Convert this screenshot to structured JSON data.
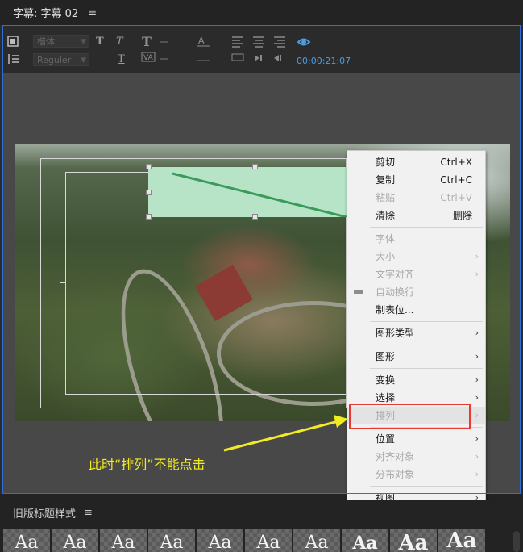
{
  "panel": {
    "title": "字幕: 字幕 02",
    "menu": "≡"
  },
  "toolbar": {
    "font_family": "楷体",
    "font_style": "Reguler",
    "bold_glyph": "T",
    "italic_glyph": "T",
    "underline_glyph": "T",
    "timecode": "00:00:21:07"
  },
  "context_menu": {
    "items": [
      {
        "label": "剪切",
        "shortcut": "Ctrl+X",
        "enabled": true
      },
      {
        "label": "复制",
        "shortcut": "Ctrl+C",
        "enabled": true
      },
      {
        "label": "粘贴",
        "shortcut": "Ctrl+V",
        "enabled": false
      },
      {
        "label": "清除",
        "shortcut": "删除",
        "enabled": true
      },
      {
        "label": "字体",
        "shortcut": "",
        "enabled": false
      },
      {
        "label": "大小",
        "shortcut": "›",
        "enabled": false
      },
      {
        "label": "文字对齐",
        "shortcut": "›",
        "enabled": false
      },
      {
        "label": "自动换行",
        "shortcut": "",
        "enabled": false
      },
      {
        "label": "制表位...",
        "shortcut": "",
        "enabled": true
      },
      {
        "label": "图形类型",
        "shortcut": "›",
        "enabled": true
      },
      {
        "label": "图形",
        "shortcut": "›",
        "enabled": true
      },
      {
        "label": "变换",
        "shortcut": "›",
        "enabled": true
      },
      {
        "label": "选择",
        "shortcut": "›",
        "enabled": true
      },
      {
        "label": "排列",
        "shortcut": "›",
        "enabled": false
      },
      {
        "label": "位置",
        "shortcut": "›",
        "enabled": true
      },
      {
        "label": "对齐对象",
        "shortcut": "›",
        "enabled": false
      },
      {
        "label": "分布对象",
        "shortcut": "›",
        "enabled": false
      },
      {
        "label": "视图",
        "shortcut": "›",
        "enabled": true
      }
    ]
  },
  "annotation": "此时“排列”不能点击",
  "bottom_panel": {
    "title": "旧版标题样式",
    "menu": "≡"
  },
  "style_swatches": [
    "Aa",
    "Aa",
    "Aa",
    "Aa",
    "Aa",
    "Aa",
    "Aa",
    "Aa",
    "Aa",
    "Aa"
  ],
  "colors": {
    "accent_blue": "#2d6fd3",
    "highlight_red": "#e63a32",
    "annotation_yellow": "#f3ec23"
  }
}
